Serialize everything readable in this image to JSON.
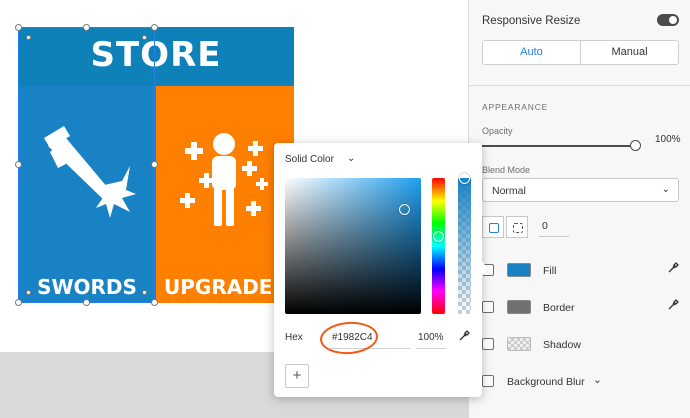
{
  "artboard": {
    "header_title": "STORE",
    "tiles": [
      {
        "label": "SWORDS",
        "color": "#1982C4"
      },
      {
        "label": "UPGRADES",
        "color": "#FF7F00"
      }
    ],
    "header_color": "#0E81B8"
  },
  "panel": {
    "responsive_resize_label": "Responsive Resize",
    "responsive_resize_on": true,
    "resize_modes": [
      "Auto",
      "Manual"
    ],
    "resize_mode_selected": "Auto",
    "appearance_title": "APPEARANCE",
    "opacity_label": "Opacity",
    "opacity_value": "100%",
    "opacity_level": 1.0,
    "blend_mode_label": "Blend Mode",
    "blend_mode_value": "Normal",
    "corner_radius_value": "0",
    "rows": [
      {
        "label": "Fill",
        "swatch": "#1982C4",
        "eyedropper": true
      },
      {
        "label": "Border",
        "swatch": "#707070",
        "eyedropper": true
      },
      {
        "label": "Shadow",
        "swatch": "checker",
        "eyedropper": false
      },
      {
        "label": "Background Blur",
        "swatch": "",
        "eyedropper": false
      }
    ]
  },
  "color_picker": {
    "mode_label": "Solid Color",
    "hex_label": "Hex",
    "hex_value": "#1982C4",
    "alpha_value": "100%",
    "add_label": "+"
  },
  "icons": {
    "chevron": "⌄",
    "eyedropper": "✎"
  }
}
